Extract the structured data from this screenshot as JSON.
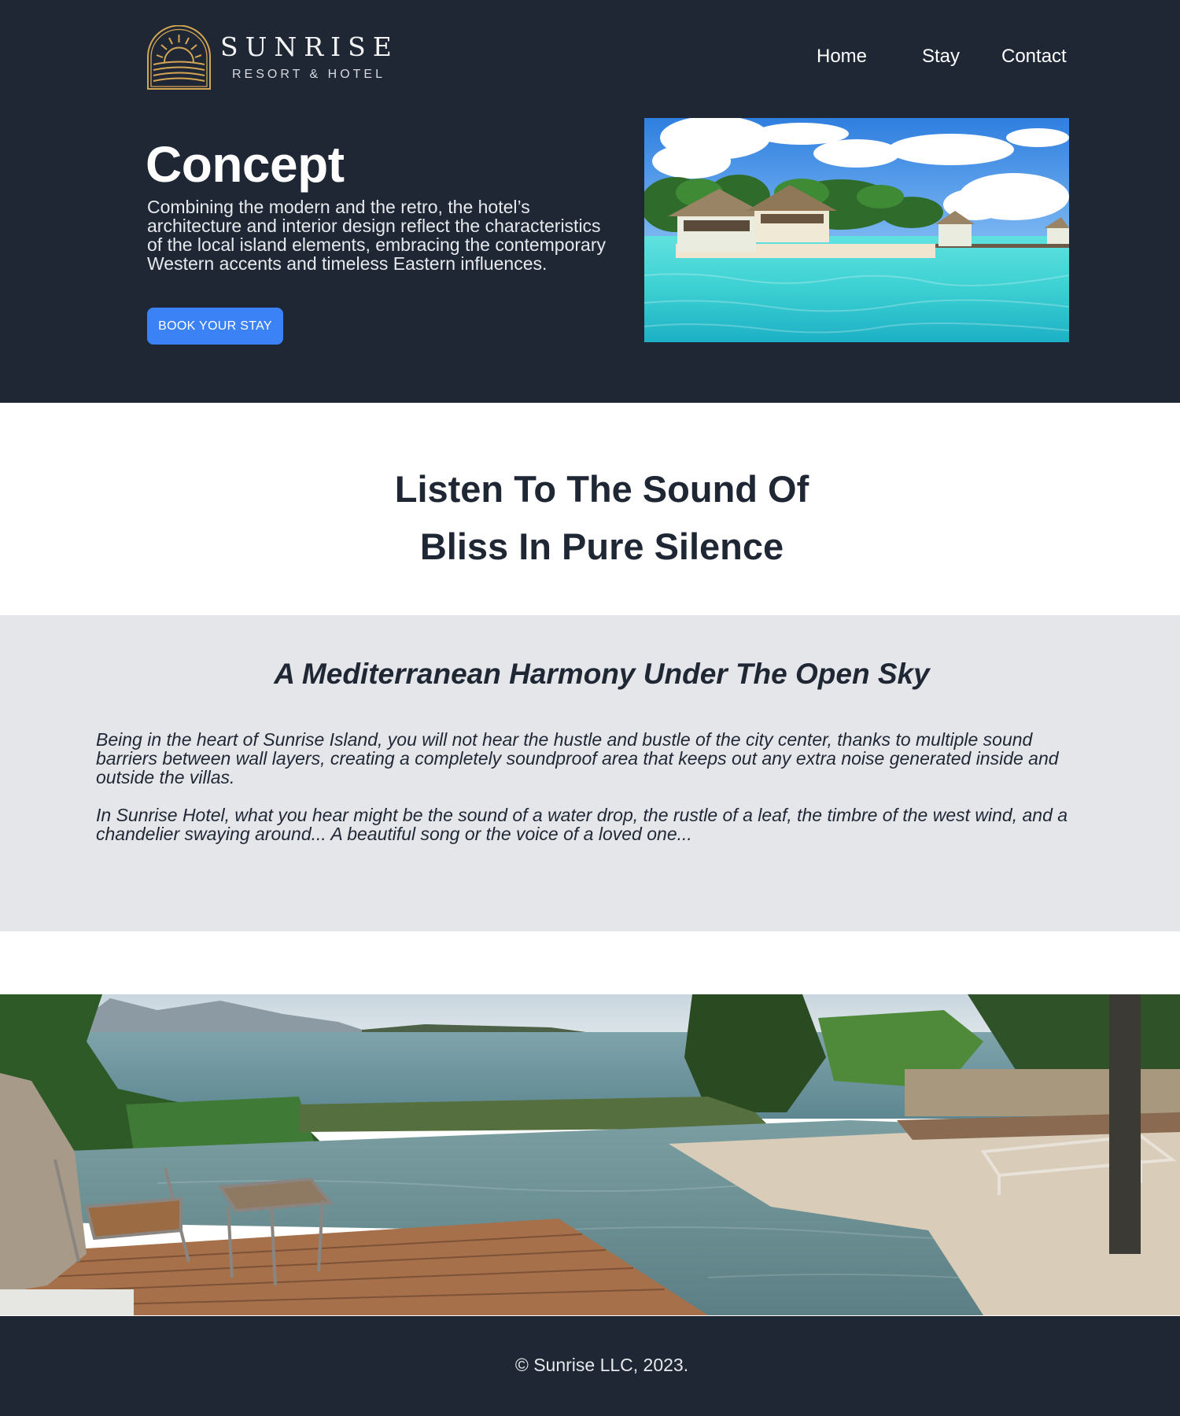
{
  "brand": {
    "name": "SUNRISE",
    "subtitle": "RESORT & HOTEL",
    "logo_icon": "sunrise-arch-icon",
    "logo_color": "#d4a654"
  },
  "nav": {
    "items": [
      {
        "label": "Home"
      },
      {
        "label": "Stay"
      },
      {
        "label": "Contact"
      }
    ]
  },
  "hero": {
    "title": "Concept",
    "text": "Combining the modern and the retro, the hotel’s architecture and interior design reflect the characteristics of the local island elements, embracing the contemporary Western accents and timeless Eastern influences.",
    "cta_label": "BOOK YOUR STAY",
    "image_subject": "tropical-water-villas-photo"
  },
  "tagline": {
    "line1": "Listen To The Sound Of",
    "line2": "Bliss In Pure Silence"
  },
  "harmony": {
    "title": "A Mediterranean Harmony Under The Open Sky",
    "paragraph1": "Being in the heart of Sunrise Island, you will not hear the hustle and bustle of the city center, thanks to multiple sound barriers between wall layers, creating a completely soundproof area that keeps out any extra noise generated inside and outside the villas.",
    "paragraph2": "In Sunrise Hotel, what you hear might be the sound of a water drop, the rustle of a leaf, the timbre of the west wind, and a chandelier swaying around... A beautiful song or the voice of a loved one..."
  },
  "showcase": {
    "image_subject": "infinity-pool-sea-view-photo"
  },
  "footer": {
    "copyright": "© Sunrise LLC, 2023."
  },
  "colors": {
    "dark": "#1f2735",
    "accent": "#3b82f6",
    "grey_section": "#e5e6e9",
    "logo_gold": "#d4a654"
  }
}
